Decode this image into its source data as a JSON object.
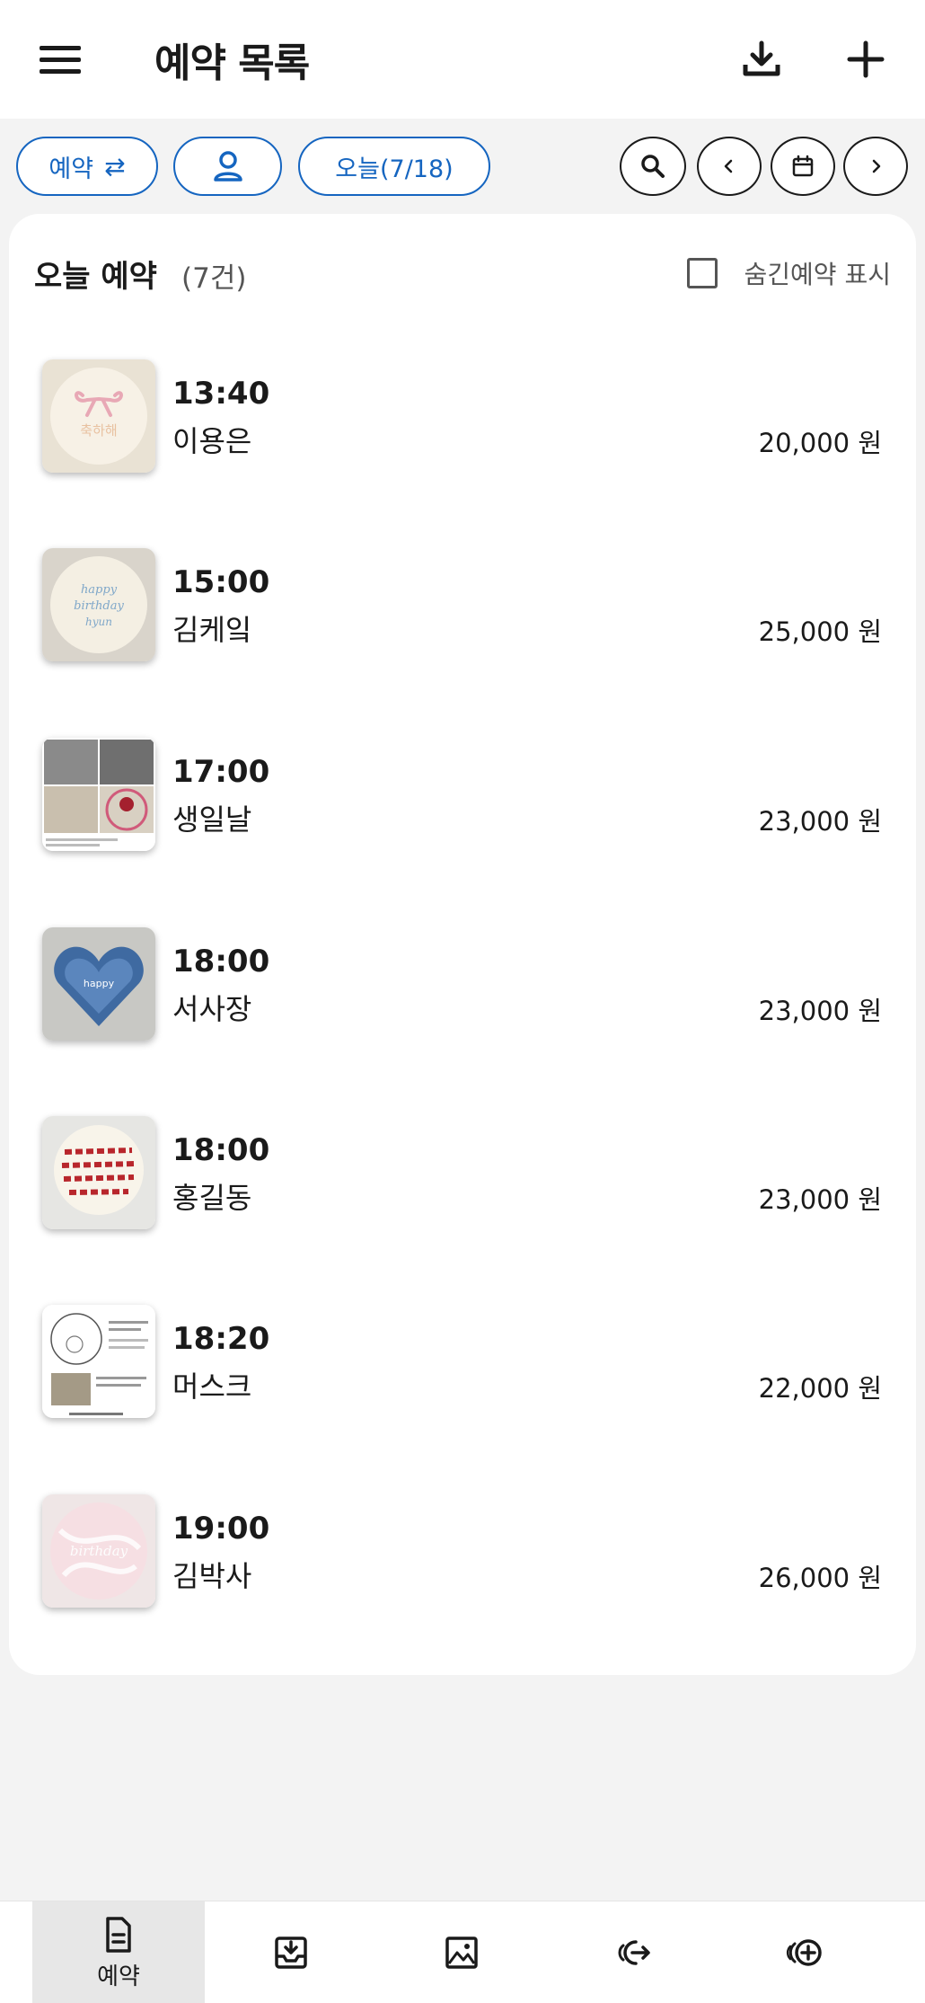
{
  "header": {
    "title": "예약 목록",
    "menu_icon": "menu-icon",
    "download_icon": "download-icon",
    "add_icon": "plus-icon"
  },
  "filters": {
    "type_pill": "예약",
    "type_pill_icon": "⇄",
    "person_icon": "person-icon",
    "date_pill": "오늘(7/18)",
    "search_icon": "search-icon",
    "prev_icon": "chevron-left-icon",
    "calendar_icon": "calendar-icon",
    "next_icon": "chevron-right-icon"
  },
  "section": {
    "title": "오늘 예약",
    "count": "(7건)",
    "hidden_label": "숨긴예약 표시",
    "hidden_checked": false
  },
  "reservations": [
    {
      "time": "13:40",
      "name": "이용은",
      "price": "20,000 원",
      "thumb": "pink-bow-cake"
    },
    {
      "time": "15:00",
      "name": "김케잌",
      "price": "25,000 원",
      "thumb": "happy-birthday-cake"
    },
    {
      "time": "17:00",
      "name": "생일날",
      "price": "23,000 원",
      "thumb": "reference-collage"
    },
    {
      "time": "18:00",
      "name": "서사장",
      "price": "23,000 원",
      "thumb": "blue-heart-cake"
    },
    {
      "time": "18:00",
      "name": "홍길동",
      "price": "23,000 원",
      "thumb": "red-lettering-cake"
    },
    {
      "time": "18:20",
      "name": "머스크",
      "price": "22,000 원",
      "thumb": "sketch-document"
    },
    {
      "time": "19:00",
      "name": "김박사",
      "price": "26,000 원",
      "thumb": "pink-marble-cake"
    }
  ],
  "bottom_nav": {
    "items": [
      {
        "label": "예약",
        "icon": "document-icon",
        "active": true
      },
      {
        "label": "",
        "icon": "inbox-download-icon",
        "active": false
      },
      {
        "label": "",
        "icon": "gallery-icon",
        "active": false
      },
      {
        "label": "",
        "icon": "logout-icon",
        "active": false
      },
      {
        "label": "",
        "icon": "add-circle-icon",
        "active": false
      }
    ]
  },
  "colors": {
    "accent": "#1565c0",
    "background": "#f3f3f3",
    "card": "#ffffff"
  }
}
